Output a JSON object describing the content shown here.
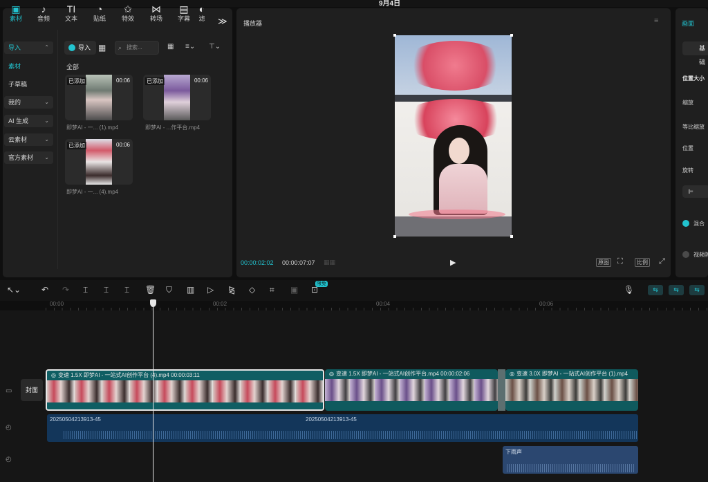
{
  "titlebar": {
    "center": "9月4日"
  },
  "media_tabs": [
    {
      "label": "素材",
      "icon": "media-icon",
      "glyph": "▣"
    },
    {
      "label": "音频",
      "icon": "audio-icon",
      "glyph": "♪"
    },
    {
      "label": "文本",
      "icon": "text-icon",
      "glyph": "TI"
    },
    {
      "label": "贴纸",
      "icon": "sticker-icon",
      "glyph": "◔"
    },
    {
      "label": "特效",
      "icon": "effects-icon",
      "glyph": "✩"
    },
    {
      "label": "转场",
      "icon": "transition-icon",
      "glyph": "⋈"
    },
    {
      "label": "字幕",
      "icon": "subtitle-icon",
      "glyph": "▤"
    },
    {
      "label": "滤",
      "icon": "filter-icon",
      "glyph": "◐"
    }
  ],
  "more_tabs_glyph": "≫",
  "sidebar": {
    "items": [
      {
        "label": "导入",
        "chev": "⌃"
      },
      {
        "label": "素材"
      },
      {
        "label": "子草稿"
      },
      {
        "label": "我的",
        "chev": "⌄"
      },
      {
        "label": "AI 生成",
        "chev": "⌄"
      },
      {
        "label": "云素材",
        "chev": "⌄"
      },
      {
        "label": "官方素材",
        "chev": "⌄"
      }
    ]
  },
  "media_toolbar": {
    "import_label": "导入",
    "search_placeholder": "搜索..."
  },
  "media_section_label": "全部",
  "media_items": [
    {
      "added": "已添加",
      "duration": "00:06",
      "name": "即梦AI - 一... (1).mp4"
    },
    {
      "added": "已添加",
      "duration": "00:06",
      "name": "即梦AI - ...作平台.mp4"
    },
    {
      "added": "已添加",
      "duration": "00:06",
      "name": "即梦AI - 一... (4).mp4"
    }
  ],
  "player": {
    "title": "播放器",
    "time_current": "00:00:02:02",
    "time_total": "00:00:07:07",
    "ctrl_1": "原图",
    "ctrl_2": "比例"
  },
  "right_panel": {
    "tab": "画面",
    "button": "基础",
    "section": "位置大小",
    "labels": [
      "缩放",
      "等比缩放",
      "位置",
      "旋转"
    ],
    "blend_label": "混合",
    "anti_shake_label": "视频防抖"
  },
  "toolbar": {
    "free_badge": "限免"
  },
  "ruler": [
    "00:00",
    "00:02",
    "00:04",
    "00:06"
  ],
  "timeline": {
    "cover_label": "封面",
    "clips": [
      {
        "header": "变速 1.5X   即梦AI - 一站式AI创作平台 (4).mp4   00:00:03:11"
      },
      {
        "header": "变速 1.5X   即梦AI - 一站式AI创作平台.mp4   00:00:02:06"
      },
      {
        "header": "变速 3.0X   即梦AI - 一站式AI创作平台 (1).mp4"
      }
    ],
    "audio_labels": [
      "20250504213913-45",
      "20250504213913-45"
    ],
    "sfx_label": "下雨声"
  },
  "colors": {
    "accent": "#22c3cf",
    "panel": "#1f1f1f",
    "audio": "#13365a"
  }
}
